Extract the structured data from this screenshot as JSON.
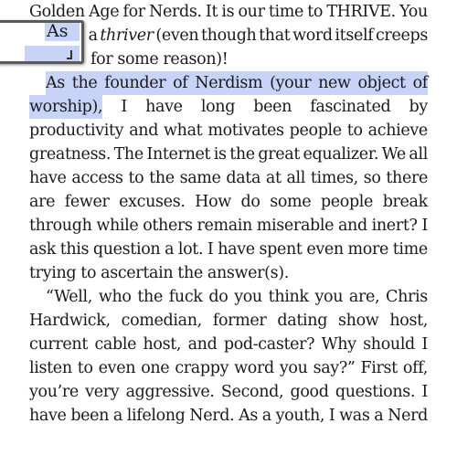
{
  "reader": {
    "lines": [
      [
        "Golden",
        "Age",
        "for",
        "Nerds.",
        "It",
        "is",
        "our",
        "time",
        "to",
        "THRIVE.",
        "You"
      ],
      [
        "a",
        "thriver",
        "(even",
        "though",
        "that",
        "word",
        "itself",
        "creeps"
      ],
      [
        "for",
        "some",
        "reason)!"
      ],
      [
        "As",
        "the",
        "founder",
        "of",
        "Nerdism",
        "(your",
        "new",
        "object",
        "of"
      ],
      [
        "worship),",
        "I",
        "have",
        "long",
        "been",
        "fascinated",
        "by"
      ],
      [
        "productivity",
        "and",
        "what",
        "motivates",
        "people",
        "to",
        "achieve"
      ],
      [
        "greatness.",
        "The",
        "Internet",
        "is",
        "the",
        "great",
        "equalizer.",
        "We",
        "all"
      ],
      [
        "have",
        "access",
        "to",
        "the",
        "same",
        "data",
        "at",
        "all",
        "times,",
        "so",
        "there"
      ],
      [
        "are",
        "fewer",
        "excuses.",
        "How",
        "do",
        "some",
        "people",
        "break"
      ],
      [
        "through",
        "while",
        "others",
        "remain",
        "miserable",
        "and",
        "inert?",
        "I"
      ],
      [
        "ask",
        "this",
        "question",
        "a",
        "lot.",
        "I",
        "have",
        "spent",
        "even",
        "more",
        "time"
      ],
      [
        "trying",
        "to",
        "ascertain",
        "the",
        "answer(s)."
      ],
      [
        "“Well,",
        "who",
        "the",
        "fuck",
        "do",
        "you",
        "think",
        "you",
        "are,",
        "Chris"
      ],
      [
        "Hardwick,",
        "comedian,",
        "former",
        "dating",
        "show",
        "host,"
      ],
      [
        "current",
        "cable",
        "host,",
        "and",
        "pod-caster?",
        "Why",
        "should",
        "I"
      ],
      [
        "listen",
        "to",
        "even",
        "one",
        "crappy",
        "word",
        "you",
        "say?”",
        "First",
        "off,"
      ],
      [
        "you’re",
        "very",
        "aggressive.",
        "Second,",
        "good",
        "questions.",
        "I"
      ],
      [
        "have",
        "been",
        "a",
        "lifelong",
        "Nerd.",
        "As",
        "a",
        "youth,",
        "I",
        "was",
        "a",
        "Nerd"
      ]
    ],
    "selected_text": "As the founder of Nerdism (your new object of worship),",
    "magnifier": {
      "text": "As"
    }
  },
  "colors": {
    "selection": "#c7d3f7",
    "text": "#1a1a1a",
    "background": "#ffffff"
  }
}
